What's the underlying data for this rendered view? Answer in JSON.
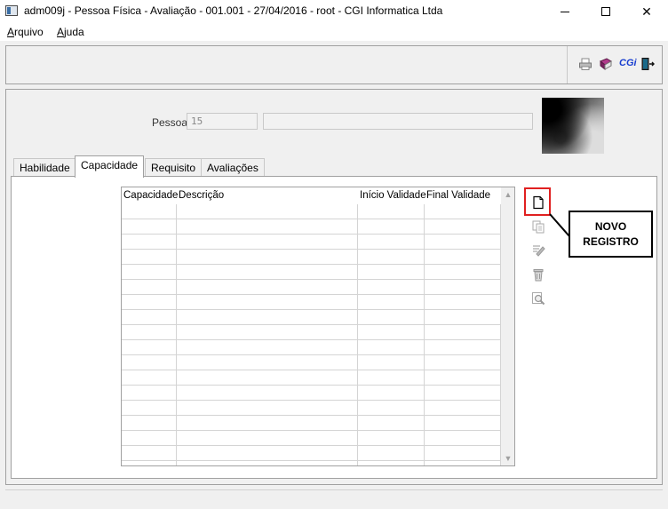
{
  "window": {
    "title": "adm009j - Pessoa Física - Avaliação - 001.001 - 27/04/2016 - root - CGI Informatica Ltda",
    "controls": {
      "minimize": "minimize",
      "maximize": "maximize",
      "close": "✕"
    }
  },
  "menu": {
    "items": [
      {
        "label": "Arquivo",
        "underline": "A",
        "rest": "rquivo"
      },
      {
        "label": "Ajuda",
        "underline": "A",
        "rest": "juda"
      }
    ]
  },
  "toolbar": {
    "icons": [
      "printer-icon",
      "book-icon",
      "cgi-logo-icon",
      "exit-door-icon"
    ],
    "cgi_label": "CGi"
  },
  "form": {
    "pessoa_label": "Pessoa:",
    "pessoa_code": "15",
    "pessoa_name": ""
  },
  "tabs": [
    {
      "label": "Habilidade",
      "active": false
    },
    {
      "label": "Capacidade",
      "active": true
    },
    {
      "label": "Requisito",
      "active": false
    },
    {
      "label": "Avaliações",
      "active": false
    }
  ],
  "grid": {
    "columns": [
      "Capacidade",
      "Descrição",
      "Início Validade",
      "Final Validade"
    ],
    "rows": []
  },
  "side_buttons": [
    "new-record-icon",
    "copy-icon",
    "edit-icon",
    "delete-icon",
    "search-icon"
  ],
  "callout": {
    "line1": "NOVO",
    "line2": "REGISTRO"
  },
  "colors": {
    "highlight": "#e02020",
    "cgi_blue": "#1a3fd0"
  }
}
